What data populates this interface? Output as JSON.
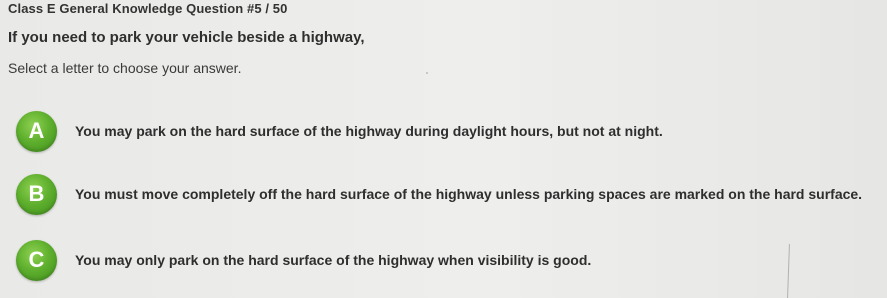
{
  "header": {
    "question_counter": "Class E General Knowledge Question #5 / 50"
  },
  "question": {
    "text": "If you need to park your vehicle beside a highway,",
    "instruction": "Select a letter to choose your answer."
  },
  "answers": [
    {
      "letter": "A",
      "text": "You may park on the hard surface of the highway during daylight hours, but not at night."
    },
    {
      "letter": "B",
      "text": "You must move completely off the hard surface of the highway unless parking spaces are marked on the hard surface."
    },
    {
      "letter": "C",
      "text": "You may only park on the hard surface of the highway when visibility is good."
    }
  ],
  "colors": {
    "letter_button": "#5fb02e",
    "background": "#ececea"
  }
}
